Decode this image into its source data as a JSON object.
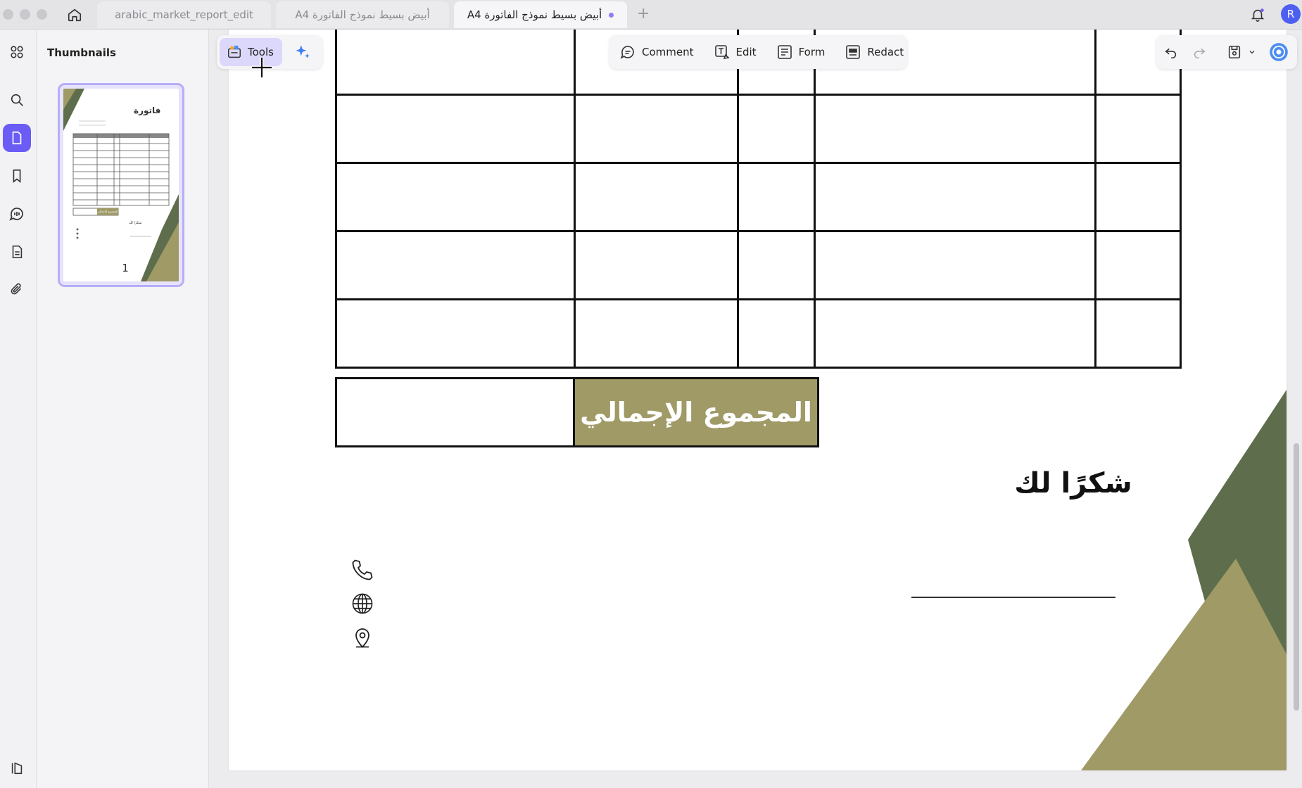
{
  "tabs": [
    {
      "label": "arabic_market_report_edit",
      "active": false
    },
    {
      "label": "أبيض بسيط نموذج الفاتورة A4",
      "active": false
    },
    {
      "label": "أبيض بسيط نموذج الفاتورة A4",
      "active": true
    }
  ],
  "user": {
    "initial": "R"
  },
  "sidebar": {
    "title": "Thumbnails",
    "page_number": "1",
    "thumbnail": {
      "title": "فاتورة",
      "total": "المجموع الإجمالي",
      "thanks": "شكرًا لك"
    }
  },
  "toolbar_left": {
    "tools_label": "Tools"
  },
  "toolbar_center": {
    "comment_label": "Comment",
    "edit_label": "Edit",
    "form_label": "Form",
    "redact_label": "Redact"
  },
  "document": {
    "total_label": "المجموع الإجمالي",
    "thanks_text": "شكرًا لك"
  },
  "colors": {
    "accent": "#6b5cf5",
    "olive": "#a09a67",
    "dark_green": "#5e6e4c"
  },
  "icons": [
    "home-icon",
    "bell-icon",
    "grid-icon",
    "search-icon",
    "page-icon",
    "bookmark-icon",
    "comment-list-icon",
    "document-icon",
    "paperclip-icon",
    "sidebar-toggle-icon",
    "tools-icon",
    "sparkle-icon",
    "comment-icon",
    "edit-icon",
    "form-icon",
    "redact-icon",
    "undo-icon",
    "redo-icon",
    "save-icon",
    "chevron-down-icon",
    "ai-assistant-icon",
    "phone-icon",
    "globe-icon",
    "location-icon"
  ]
}
